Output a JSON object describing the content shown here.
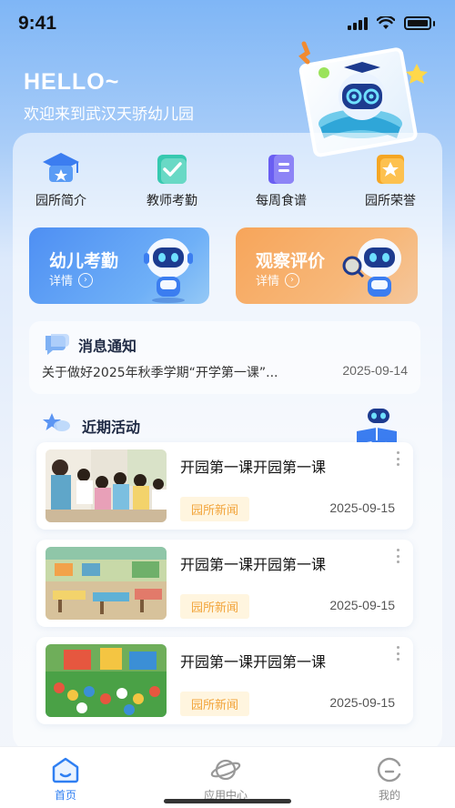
{
  "status_bar": {
    "time": "9:41"
  },
  "header": {
    "hello": "HELLO~",
    "welcome": "欢迎来到武汉天骄幼儿园"
  },
  "quick_menu": [
    {
      "label": "园所简介",
      "icon": "school-icon"
    },
    {
      "label": "教师考勤",
      "icon": "checkin-icon"
    },
    {
      "label": "每周食谱",
      "icon": "recipe-book-icon"
    },
    {
      "label": "园所荣誉",
      "icon": "honor-star-icon"
    }
  ],
  "features": {
    "attendance": {
      "title": "幼儿考勤",
      "detail": "详情"
    },
    "evaluation": {
      "title": "观察评价",
      "detail": "详情"
    }
  },
  "notice": {
    "title": "消息通知",
    "text": "关于做好2025年秋季学期“开学第一课”...",
    "date": "2025-09-14"
  },
  "activities": {
    "title": "近期活动",
    "items": [
      {
        "title": "开园第一课开园第一课",
        "tag": "园所新闻",
        "date": "2025-09-15"
      },
      {
        "title": "开园第一课开园第一课",
        "tag": "园所新闻",
        "date": "2025-09-15"
      },
      {
        "title": "开园第一课开园第一课",
        "tag": "园所新闻",
        "date": "2025-09-15"
      }
    ]
  },
  "tab_bar": {
    "home": "首页",
    "apps": "应用中心",
    "mine": "我的"
  },
  "colors": {
    "accent": "#2f7ff2",
    "tag_bg": "#fff5df",
    "tag_text": "#f2a43a",
    "feature_blue": "#4e8ff3",
    "feature_orange": "#f7a55a"
  }
}
